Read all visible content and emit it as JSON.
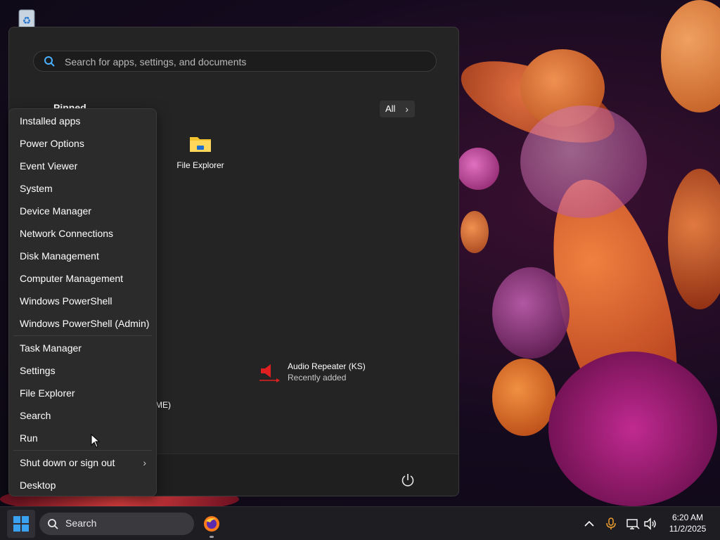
{
  "start_menu": {
    "search_placeholder": "Search for apps, settings, and documents",
    "pinned_label": "Pinned",
    "all_label": "All",
    "pinned_apps": [
      {
        "label": "File Explorer",
        "icon": "folder-icon"
      }
    ],
    "recommended": [
      {
        "title": "Audio Repeater (KS)",
        "subtitle": "Recently added",
        "icon": "speaker-icon"
      }
    ],
    "partial_text": "ME)"
  },
  "context_menu": {
    "items": [
      "Installed apps",
      "Power Options",
      "Event Viewer",
      "System",
      "Device Manager",
      "Network Connections",
      "Disk Management",
      "Computer Management",
      "Windows PowerShell",
      "Windows PowerShell (Admin)",
      "Task Manager",
      "Settings",
      "File Explorer",
      "Search",
      "Run",
      "Shut down or sign out",
      "Desktop"
    ]
  },
  "taskbar": {
    "search_label": "Search",
    "time": "6:20 AM",
    "date": "11/2/2025"
  },
  "colors": {
    "accent_blue": "#0a84ff",
    "audio_red": "#e02020"
  }
}
